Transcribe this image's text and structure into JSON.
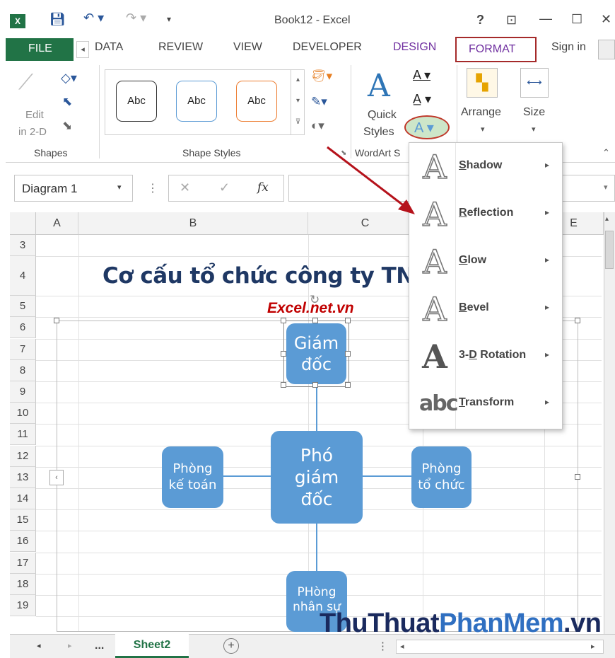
{
  "window": {
    "title": "Book12 - Excel",
    "controls": [
      "?",
      "⊡",
      "—",
      "☐",
      "✕"
    ]
  },
  "ribbon_tabs": {
    "file": "FILE",
    "data": "DATA",
    "review": "REVIEW",
    "view": "VIEW",
    "developer": "DEVELOPER",
    "design": "DESIGN",
    "format": "FORMAT",
    "sign_in": "Sign in"
  },
  "ribbon": {
    "shapes": {
      "edit_label": "Edit",
      "in2d_label": "in 2-D",
      "group": "Shapes"
    },
    "shape_styles": {
      "group": "Shape Styles",
      "samples": [
        "Abc",
        "Abc",
        "Abc"
      ],
      "sample_colors": [
        "#333333",
        "#5b9bd5",
        "#ed7d31"
      ]
    },
    "wordart": {
      "quick": "Quick",
      "styles": "Styles",
      "group": "WordArt S"
    },
    "arrange": "Arrange",
    "size": "Size"
  },
  "formula_bar": {
    "name_box": "Diagram 1",
    "fx": "fx"
  },
  "columns": [
    "A",
    "B",
    "C",
    "E"
  ],
  "rows": [
    "3",
    "4",
    "5",
    "6",
    "7",
    "8",
    "9",
    "10",
    "11",
    "12",
    "13",
    "14",
    "15",
    "16",
    "17",
    "18",
    "19"
  ],
  "sheet": {
    "title": "Cơ cấu tổ chức công ty TN",
    "subtitle": "Excel.net.vn",
    "title_color": "#1f3864",
    "subtitle_color": "#c00000"
  },
  "org_chart": {
    "top": "Giám đốc",
    "center": "Phó giám đốc",
    "left": "Phòng kế toán",
    "right": "Phòng tổ chức",
    "bottom": "PHòng nhân sự",
    "fill": "#5b9bd5"
  },
  "wordart_effects_menu": [
    {
      "glyph": "A",
      "label": "Shadow",
      "accel": "S"
    },
    {
      "glyph": "A",
      "label": "Reflection",
      "accel": "R"
    },
    {
      "glyph": "A",
      "label": "Glow",
      "accel": "G"
    },
    {
      "glyph": "A",
      "label": "Bevel",
      "accel": "B"
    },
    {
      "glyph": "A",
      "label": "3-D Rotation",
      "accel": "D"
    },
    {
      "glyph": "abc",
      "label": "Transform",
      "accel": "T"
    }
  ],
  "sheet_tabs": {
    "ellipsis": "...",
    "active": "Sheet2"
  },
  "watermark": {
    "part1": "ThuThuat",
    "part2": "PhanMem",
    "part3": ".vn"
  }
}
